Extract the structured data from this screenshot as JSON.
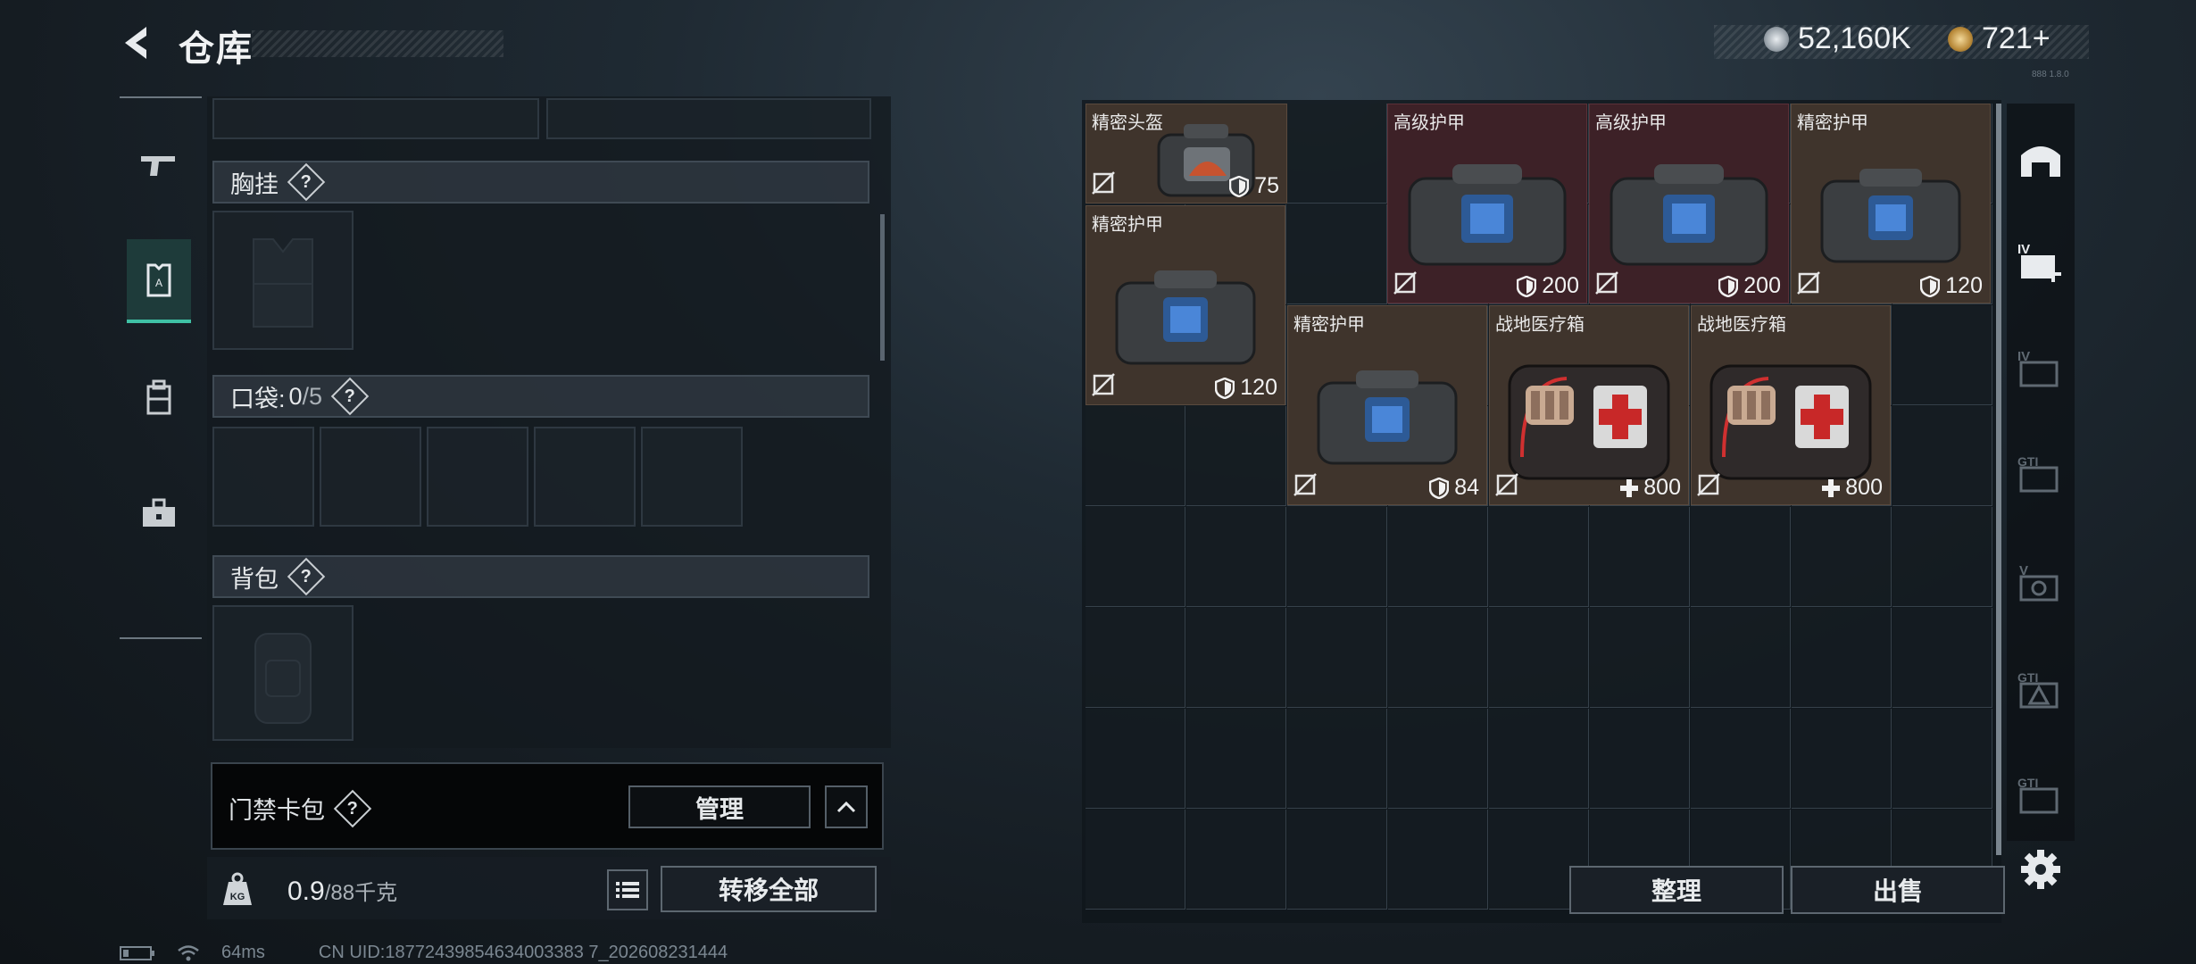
{
  "header": {
    "title": "仓库",
    "currency_1": "52,160K",
    "currency_2": "721+",
    "build": "888 1.8.0"
  },
  "equipment": {
    "chest_rig_label": "胸挂",
    "pocket_label": "口袋:",
    "pocket_count": "0",
    "pocket_total": "/5",
    "backpack_label": "背包",
    "keycard_label": "门禁卡包",
    "manage_label": "管理",
    "weight_value": "0.9",
    "weight_max": "/88千克",
    "weight_icon": "KG",
    "transfer_label": "转移全部"
  },
  "stash": {
    "items": [
      {
        "name": "精密头盔",
        "value": "75",
        "stat": "shield"
      },
      {
        "name": "高级护甲",
        "value": "200",
        "stat": "shield"
      },
      {
        "name": "高级护甲",
        "value": "200",
        "stat": "shield"
      },
      {
        "name": "精密护甲",
        "value": "120",
        "stat": "shield"
      },
      {
        "name": "精密护甲",
        "value": "120",
        "stat": "shield"
      },
      {
        "name": "精密护甲",
        "value": "84",
        "stat": "shield"
      },
      {
        "name": "战地医疗箱",
        "value": "800",
        "stat": "heal"
      },
      {
        "name": "战地医疗箱",
        "value": "800",
        "stat": "heal"
      }
    ],
    "sort_label": "整理",
    "sell_label": "出售"
  },
  "right_nav": {
    "items": [
      {
        "icon": "stash-icon"
      },
      {
        "icon": "add-stash-iv-icon",
        "label": "IV"
      },
      {
        "icon": "stash-iv-icon",
        "label": "IV"
      },
      {
        "icon": "stash-gti-icon",
        "label": "GTI"
      },
      {
        "icon": "stash-v-icon",
        "label": "V"
      },
      {
        "icon": "stash-gti-icon",
        "label": "GTI"
      },
      {
        "icon": "stash-gti-icon",
        "label": "GTI"
      }
    ]
  },
  "status": {
    "ping": "64ms",
    "uid": "CN UID:18772439854634003383 7_202608231444"
  },
  "colors": {
    "accent": "#3fc1a5",
    "item_brown": "#3f342c",
    "item_red": "#3d2127"
  }
}
